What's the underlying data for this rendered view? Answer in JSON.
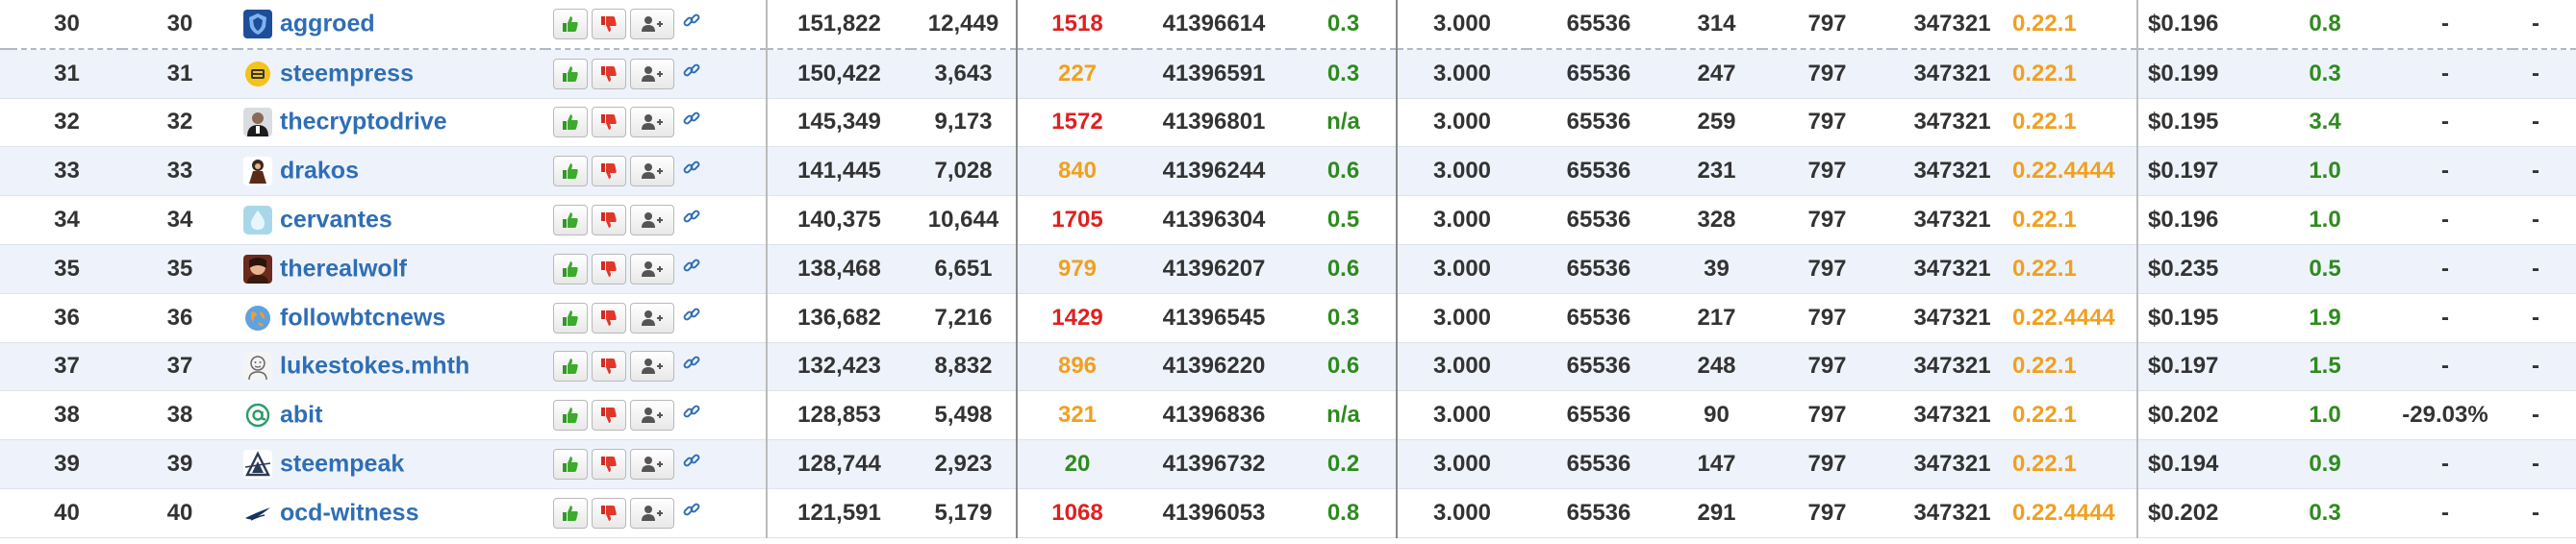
{
  "colors": {
    "link": "#2f6eb5",
    "missed_high": "#e02020",
    "missed_mid": "#f0a020",
    "missed_low": "#2e8b1e",
    "positive": "#2e8b1e",
    "version_highlight": "#f0a020",
    "row_alt": "#eef3fb"
  },
  "rows": [
    {
      "rank": "30",
      "rank2": "30",
      "avatar_icon": "blue-shield-icon",
      "name": "aggroed",
      "votes": "151,822",
      "voters": "12,449",
      "missed": "1518",
      "missed_level": "red",
      "last_block": "41396614",
      "apr": "0.3",
      "fee": "3.000",
      "block_size": "65536",
      "sbd_days": "314",
      "hf": "797",
      "last_confirmed": "347321",
      "version": "0.22.1",
      "price": "$0.196",
      "price_age": "0.8",
      "bias": "-",
      "extra": "-"
    },
    {
      "rank": "31",
      "rank2": "31",
      "avatar_icon": "steempress-icon",
      "name": "steempress",
      "votes": "150,422",
      "voters": "3,643",
      "missed": "227",
      "missed_level": "orange",
      "last_block": "41396591",
      "apr": "0.3",
      "fee": "3.000",
      "block_size": "65536",
      "sbd_days": "247",
      "hf": "797",
      "last_confirmed": "347321",
      "version": "0.22.1",
      "price": "$0.199",
      "price_age": "0.3",
      "bias": "-",
      "extra": "-"
    },
    {
      "rank": "32",
      "rank2": "32",
      "avatar_icon": "person-photo-icon",
      "name": "thecryptodrive",
      "votes": "145,349",
      "voters": "9,173",
      "missed": "1572",
      "missed_level": "red",
      "last_block": "41396801",
      "apr": "n/a",
      "fee": "3.000",
      "block_size": "65536",
      "sbd_days": "259",
      "hf": "797",
      "last_confirmed": "347321",
      "version": "0.22.1",
      "price": "$0.195",
      "price_age": "3.4",
      "bias": "-",
      "extra": "-"
    },
    {
      "rank": "33",
      "rank2": "33",
      "avatar_icon": "character-icon",
      "name": "drakos",
      "votes": "141,445",
      "voters": "7,028",
      "missed": "840",
      "missed_level": "orange",
      "last_block": "41396244",
      "apr": "0.6",
      "fee": "3.000",
      "block_size": "65536",
      "sbd_days": "231",
      "hf": "797",
      "last_confirmed": "347321",
      "version": "0.22.4444",
      "price": "$0.197",
      "price_age": "1.0",
      "bias": "-",
      "extra": "-"
    },
    {
      "rank": "34",
      "rank2": "34",
      "avatar_icon": "droplet-icon",
      "name": "cervantes",
      "votes": "140,375",
      "voters": "10,644",
      "missed": "1705",
      "missed_level": "red",
      "last_block": "41396304",
      "apr": "0.5",
      "fee": "3.000",
      "block_size": "65536",
      "sbd_days": "328",
      "hf": "797",
      "last_confirmed": "347321",
      "version": "0.22.1",
      "price": "$0.196",
      "price_age": "1.0",
      "bias": "-",
      "extra": "-"
    },
    {
      "rank": "35",
      "rank2": "35",
      "avatar_icon": "wolf-portrait-icon",
      "name": "therealwolf",
      "votes": "138,468",
      "voters": "6,651",
      "missed": "979",
      "missed_level": "orange",
      "last_block": "41396207",
      "apr": "0.6",
      "fee": "3.000",
      "block_size": "65536",
      "sbd_days": "39",
      "hf": "797",
      "last_confirmed": "347321",
      "version": "0.22.1",
      "price": "$0.235",
      "price_age": "0.5",
      "bias": "-",
      "extra": "-"
    },
    {
      "rank": "36",
      "rank2": "36",
      "avatar_icon": "globe-icon",
      "name": "followbtcnews",
      "votes": "136,682",
      "voters": "7,216",
      "missed": "1429",
      "missed_level": "red",
      "last_block": "41396545",
      "apr": "0.3",
      "fee": "3.000",
      "block_size": "65536",
      "sbd_days": "217",
      "hf": "797",
      "last_confirmed": "347321",
      "version": "0.22.4444",
      "price": "$0.195",
      "price_age": "1.9",
      "bias": "-",
      "extra": "-"
    },
    {
      "rank": "37",
      "rank2": "37",
      "avatar_icon": "face-sketch-icon",
      "name": "lukestokes.mhth",
      "votes": "132,423",
      "voters": "8,832",
      "missed": "896",
      "missed_level": "orange",
      "last_block": "41396220",
      "apr": "0.6",
      "fee": "3.000",
      "block_size": "65536",
      "sbd_days": "248",
      "hf": "797",
      "last_confirmed": "347321",
      "version": "0.22.1",
      "price": "$0.197",
      "price_age": "1.5",
      "bias": "-",
      "extra": "-"
    },
    {
      "rank": "38",
      "rank2": "38",
      "avatar_icon": "at-sign-icon",
      "name": "abit",
      "votes": "128,853",
      "voters": "5,498",
      "missed": "321",
      "missed_level": "orange",
      "last_block": "41396836",
      "apr": "n/a",
      "fee": "3.000",
      "block_size": "65536",
      "sbd_days": "90",
      "hf": "797",
      "last_confirmed": "347321",
      "version": "0.22.1",
      "price": "$0.202",
      "price_age": "1.0",
      "bias": "-29.03%",
      "extra": "-"
    },
    {
      "rank": "39",
      "rank2": "39",
      "avatar_icon": "triangle-logo-icon",
      "name": "steempeak",
      "votes": "128,744",
      "voters": "2,923",
      "missed": "20",
      "missed_level": "green",
      "last_block": "41396732",
      "apr": "0.2",
      "fee": "3.000",
      "block_size": "65536",
      "sbd_days": "147",
      "hf": "797",
      "last_confirmed": "347321",
      "version": "0.22.1",
      "price": "$0.194",
      "price_age": "0.9",
      "bias": "-",
      "extra": "-"
    },
    {
      "rank": "40",
      "rank2": "40",
      "avatar_icon": "wing-logo-icon",
      "name": "ocd-witness",
      "votes": "121,591",
      "voters": "5,179",
      "missed": "1068",
      "missed_level": "red",
      "last_block": "41396053",
      "apr": "0.8",
      "fee": "3.000",
      "block_size": "65536",
      "sbd_days": "291",
      "hf": "797",
      "last_confirmed": "347321",
      "version": "0.22.4444",
      "price": "$0.202",
      "price_age": "0.3",
      "bias": "-",
      "extra": "-"
    }
  ]
}
